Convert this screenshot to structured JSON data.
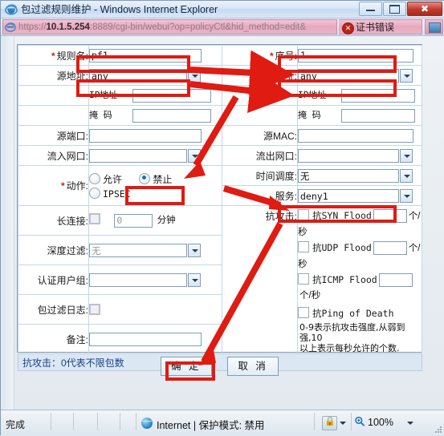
{
  "window": {
    "title": "包过滤规则维护 - Windows Internet Explorer",
    "minimize_label": "最小化",
    "maximize_label": "最大化",
    "close_label": "关闭"
  },
  "address_bar": {
    "url_prefix": "https://",
    "url_host": "10.1.5.254",
    "url_suffix": ":8889/cgi-bin/webui?op=policyCtl&hid_method=edit&",
    "cert_error_label": "证书错误",
    "ie_icon": "ie-logo-icon",
    "cert_icon": "cert-error-icon",
    "right_button_icon": "page-preview-icon"
  },
  "form": {
    "rule_name": {
      "label": "规则名:",
      "required": true,
      "value": "pf1"
    },
    "seq_no": {
      "label": "序号:",
      "required": true,
      "value": "1"
    },
    "src_addr": {
      "label": "源地址:",
      "value": "any"
    },
    "dst_addr": {
      "label": "目的地址:",
      "value": "any"
    },
    "src_ip": {
      "label": "IP地址",
      "value": ""
    },
    "src_mask": {
      "label": "掩  码",
      "value": ""
    },
    "dst_ip": {
      "label": "IP地址",
      "value": ""
    },
    "dst_mask": {
      "label": "掩  码",
      "value": ""
    },
    "src_port": {
      "label": "源端口:",
      "value": ""
    },
    "src_mac": {
      "label": "源MAC:",
      "value": ""
    },
    "in_iface": {
      "label": "流入网口:",
      "value": ""
    },
    "out_iface": {
      "label": "流出网口:",
      "value": ""
    },
    "action": {
      "label": "动作:",
      "required": true,
      "options": [
        "允许",
        "禁止",
        "IPSEC"
      ],
      "selected": "禁止"
    },
    "time_sched": {
      "label": "时间调度:",
      "value": "无"
    },
    "service": {
      "label": "服务:",
      "value": "deny1"
    },
    "long_conn": {
      "label": "长连接:",
      "checked": false,
      "value": "0",
      "unit": "分钟"
    },
    "deep_filter": {
      "label": "深度过滤:",
      "value": "无"
    },
    "auth_group": {
      "label": "认证用户组:",
      "value": ""
    },
    "pkt_log": {
      "label": "包过滤日志:",
      "checked": false
    },
    "remark": {
      "label": "备注:",
      "value": ""
    },
    "anti_attack": {
      "label": "抗攻击:",
      "items": [
        {
          "label": "抗SYN  Flood",
          "checked": false,
          "value": "",
          "unit": "个/秒"
        },
        {
          "label": "抗UDP  Flood",
          "checked": false,
          "value": "",
          "unit": "个/秒"
        },
        {
          "label": "抗ICMP Flood",
          "checked": false,
          "value": "",
          "unit": "个/秒"
        },
        {
          "label": "抗Ping of Death",
          "checked": false,
          "value": "",
          "unit": ""
        }
      ],
      "note_line1": "0-9表示抗攻击强度,从弱到强,10",
      "note_line2": "以上表示每秒允许的个数."
    },
    "hint": "抗攻击：0代表不限包数"
  },
  "buttons": {
    "ok": "确 定",
    "cancel": "取 消"
  },
  "status_bar": {
    "status_text": "完成",
    "zone_text": "Internet | 保护模式: 禁用",
    "zoom_level": "100%",
    "globe_icon": "internet-zone-icon",
    "lock_icon": "privacy-lock-icon",
    "zoom_icon": "zoom-magnifier-icon",
    "resize_grip_icon": "resize-grip-icon"
  },
  "annotations": {
    "accent_color": "#e01b12",
    "highlight_count": 6
  }
}
